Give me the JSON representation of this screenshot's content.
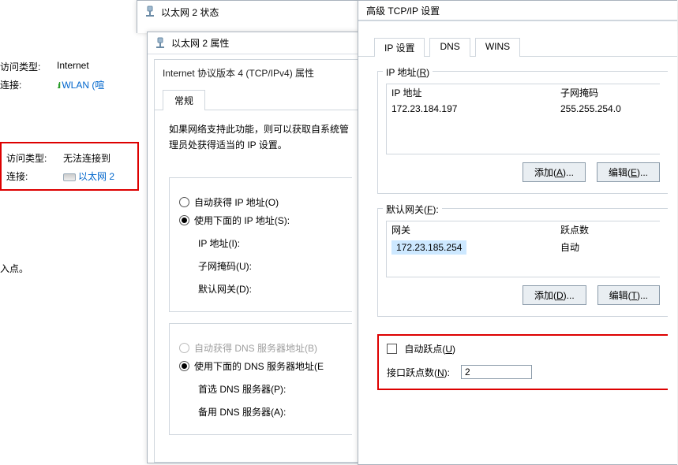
{
  "background": {
    "internet_group": {
      "access_label": "访问类型:",
      "access_value": "Internet",
      "conn_label": "连接:",
      "wlan_text": "WLAN (喧"
    },
    "ethernet_group": {
      "access_label": "访问类型:",
      "access_value": "无法连接到",
      "conn_label": "连接:",
      "eth_text": "以太网 2"
    },
    "entry_note": "入点。"
  },
  "status_dialog": {
    "title": "以太网 2 状态"
  },
  "props_dialog": {
    "title": "以太网 2 属性",
    "inner_title": "Internet 协议版本 4 (TCP/IPv4) 属性",
    "tab_general": "常规",
    "description": "如果网络支持此功能，则可以获取自系统管理员处获得适当的 IP 设置。",
    "ip_section": {
      "r_auto": "自动获得 IP 地址(O)",
      "r_use": "使用下面的 IP 地址(S):",
      "ip_label": "IP 地址(I):",
      "mask_label": "子网掩码(U):",
      "gw_label": "默认网关(D):"
    },
    "dns_section": {
      "r_auto": "自动获得 DNS 服务器地址(B)",
      "r_use": "使用下面的 DNS 服务器地址(E",
      "pref": "首选 DNS 服务器(P):",
      "alt": "备用 DNS 服务器(A):"
    }
  },
  "adv_dialog": {
    "title": "高级 TCP/IP 设置",
    "tabs": {
      "ip": "IP 设置",
      "dns": "DNS",
      "wins": "WINS"
    },
    "ip_group": {
      "legend_pre": "IP 地址(",
      "legend_und": "R",
      "legend_post": ")",
      "col_ip": "IP 地址",
      "col_mask": "子网掩码",
      "row_ip": "172.23.184.197",
      "row_mask": "255.255.254.0"
    },
    "gw_group": {
      "legend_pre": "默认网关(",
      "legend_und": "F",
      "legend_post": "):",
      "col_gw": "网关",
      "col_metric": "跃点数",
      "row_gw": "172.23.185.254",
      "row_metric": "自动"
    },
    "btns": {
      "add_a_pre": "添加(",
      "add_a_und": "A",
      "add_a_post": ")...",
      "edit_e_pre": "编辑(",
      "edit_e_und": "E",
      "edit_e_post": ")...",
      "add_d_pre": "添加(",
      "add_d_und": "D",
      "add_d_post": ")...",
      "edit_t_pre": "编辑(",
      "edit_t_und": "T",
      "edit_t_post": ")..."
    },
    "metric": {
      "auto_pre": "自动跃点(",
      "auto_und": "U",
      "auto_post": ")",
      "label_pre": "接口跃点数(",
      "label_und": "N",
      "label_post": "):",
      "value": "2"
    }
  }
}
